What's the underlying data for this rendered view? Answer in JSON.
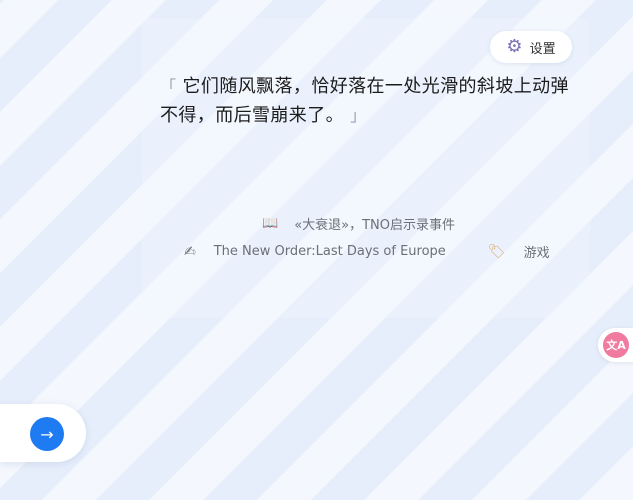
{
  "settings": {
    "icon": "gear-icon",
    "label": "设置"
  },
  "quote": {
    "open_mark": "「",
    "text": "它们随风飘落，恰好落在一处光滑的斜坡上动弹不得，而后雪崩来了。",
    "close_mark": "」"
  },
  "source": {
    "icon": "book-icon",
    "text": "«大衰退»，TNO启示录事件"
  },
  "meta": {
    "author_icon": "writing-hand-icon",
    "author": "The New Order:Last Days of Europe",
    "tag_icon": "tag-icon",
    "tag": "游戏"
  },
  "next": {
    "icon": "arrow-right-icon",
    "symbol": "→"
  },
  "translate": {
    "icon": "translate-icon",
    "symbol": "文A"
  },
  "colors": {
    "accent": "#1f7bf2",
    "translate": "#f07aa0",
    "background": "#e6eefb"
  }
}
